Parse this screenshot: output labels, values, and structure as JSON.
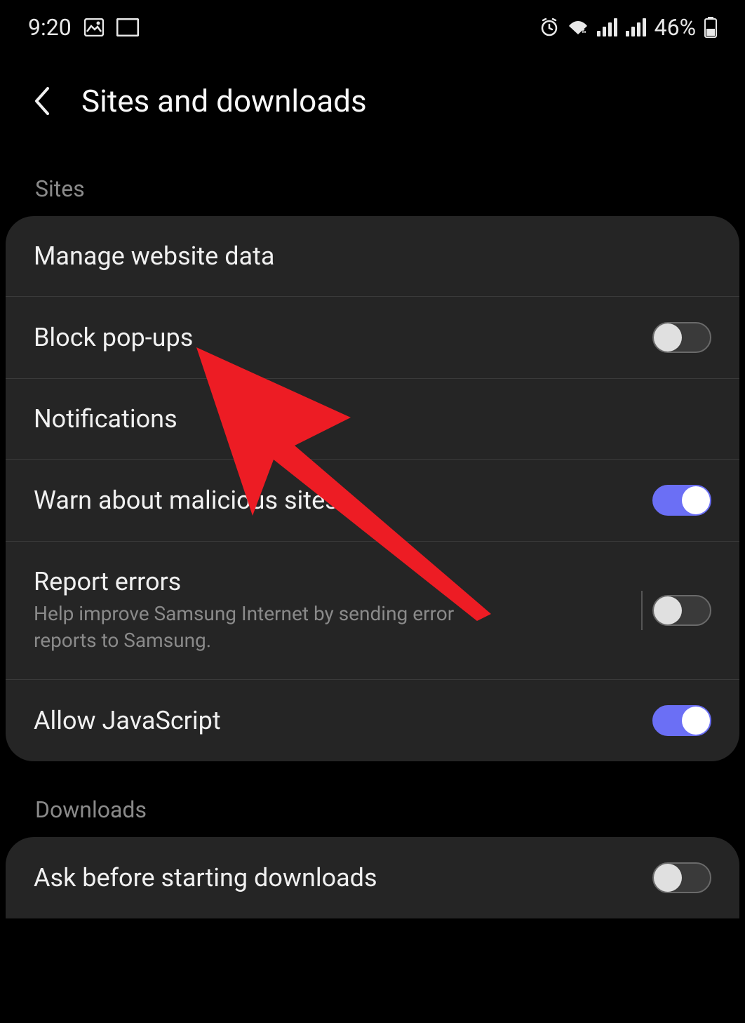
{
  "status": {
    "time": "9:20",
    "battery": "46%"
  },
  "header": {
    "title": "Sites and downloads"
  },
  "sections": {
    "sites": {
      "label": "Sites",
      "items": {
        "manage_data": {
          "title": "Manage website data"
        },
        "block_popups": {
          "title": "Block pop-ups",
          "enabled": false
        },
        "notifications": {
          "title": "Notifications"
        },
        "warn_malicious": {
          "title": "Warn about malicious sites",
          "enabled": true
        },
        "report_errors": {
          "title": "Report errors",
          "subtitle": "Help improve Samsung Internet by sending error reports to Samsung.",
          "enabled": false
        },
        "allow_js": {
          "title": "Allow JavaScript",
          "enabled": true
        }
      }
    },
    "downloads": {
      "label": "Downloads",
      "items": {
        "ask_before": {
          "title": "Ask before starting downloads",
          "enabled": false
        }
      }
    }
  }
}
